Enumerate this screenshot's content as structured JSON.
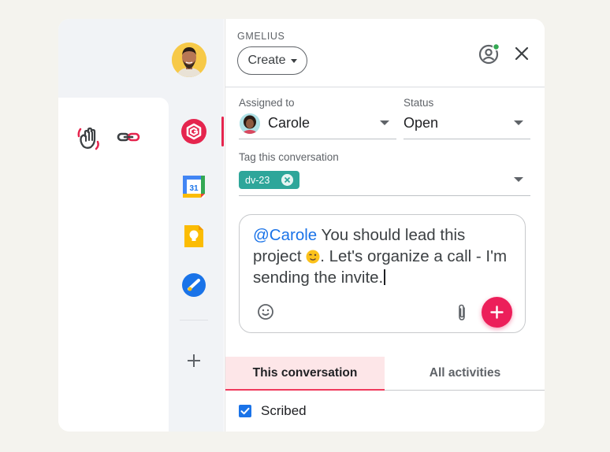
{
  "panel": {
    "brand": "GMELIUS",
    "create_label": "Create",
    "assigned_label": "Assigned to",
    "assigned_value": "Carole",
    "status_label": "Status",
    "status_value": "Open",
    "tag_label": "Tag this conversation",
    "tag_chip": "dv-23"
  },
  "compose": {
    "mention": "@Carole",
    "text_part1": " You should lead this project ",
    "text_part2": ". Let's organize a call - I'm sending the invite."
  },
  "tabs": {
    "active": "This conversation",
    "inactive": "All activities"
  },
  "subscribed_label": "Scribed",
  "sidebar": {
    "calendar_day": "31"
  },
  "colors": {
    "accent": "#ec1f5a",
    "tag": "#2ea69a",
    "link": "#1a73e8",
    "status_dot": "#34a853"
  }
}
